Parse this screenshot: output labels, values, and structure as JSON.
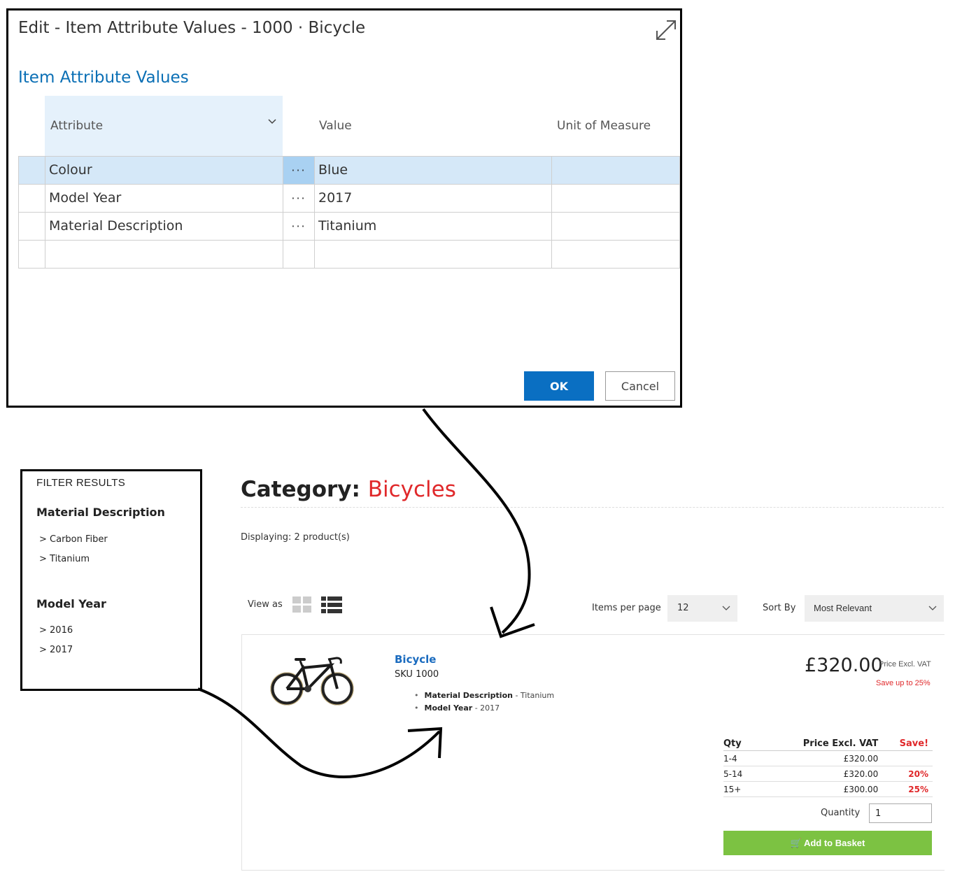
{
  "dialog": {
    "title": "Edit - Item Attribute Values - 1000 · Bicycle",
    "heading": "Item Attribute Values",
    "columns": {
      "attribute": "Attribute",
      "value": "Value",
      "unit": "Unit of Measure"
    },
    "rows": [
      {
        "attribute": "Colour",
        "assist": "···",
        "value": "Blue",
        "unit": ""
      },
      {
        "attribute": "Model Year",
        "assist": "···",
        "value": "2017",
        "unit": ""
      },
      {
        "attribute": "Material Description",
        "assist": "···",
        "value": "Titanium",
        "unit": ""
      },
      {
        "attribute": "",
        "assist": "",
        "value": "",
        "unit": ""
      }
    ],
    "ok_label": "OK",
    "cancel_label": "Cancel",
    "accent_color": "#0a6fc2"
  },
  "filter": {
    "title": "FILTER RESULTS",
    "sections": [
      {
        "label": "Material Description",
        "items": [
          "> Carbon Fiber",
          "> Titanium"
        ]
      },
      {
        "label": "Model Year",
        "items": [
          "> 2016",
          "> 2017"
        ]
      }
    ]
  },
  "shop": {
    "category_prefix": "Category:",
    "category_name": "Bicycles",
    "displaying": "Displaying: 2 product(s)",
    "view_as": "View as",
    "items_per_page_label": "Items per page",
    "items_per_page_value": "12",
    "sort_by_label": "Sort By",
    "sort_by_value": "Most Relevant",
    "product": {
      "name": "Bicycle",
      "sku": "SKU 1000",
      "attributes": [
        {
          "name": "Material Description",
          "value": " - Titanium"
        },
        {
          "name": "Model Year",
          "value": " - 2017"
        }
      ],
      "price": "£320.00",
      "price_note": "Price Excl. VAT",
      "save_note": "Save up to 25%",
      "price_table": {
        "headers": [
          "Qty",
          "Price Excl. VAT",
          "Save!"
        ],
        "rows": [
          {
            "qty": "1-4",
            "price": "£320.00",
            "save": ""
          },
          {
            "qty": "5-14",
            "price": "£320.00",
            "save": "20%"
          },
          {
            "qty": "15+",
            "price": "£300.00",
            "save": "25%"
          }
        ]
      },
      "quantity_label": "Quantity",
      "quantity_value": "1",
      "add_to_basket": "Add to Basket"
    },
    "colors": {
      "accent_red": "#e0282a",
      "link_blue": "#1a6bbf",
      "basket_green": "#7cc242"
    }
  }
}
